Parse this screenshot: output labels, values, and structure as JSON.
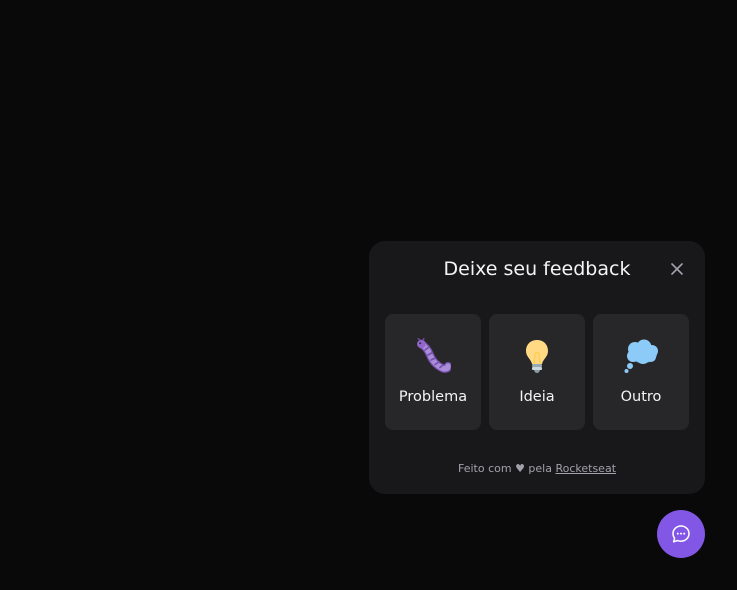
{
  "widget": {
    "title": "Deixe seu feedback",
    "close_icon": "close-icon",
    "types": [
      {
        "label": "Problema",
        "icon": "bug-icon"
      },
      {
        "label": "Ideia",
        "icon": "lightbulb-icon"
      },
      {
        "label": "Outro",
        "icon": "thought-cloud-icon"
      }
    ],
    "footer": {
      "prefix": "Feito com ♥ pela",
      "link": "Rocketseat"
    }
  },
  "fab": {
    "icon": "chat-icon"
  },
  "colors": {
    "background": "#09090a",
    "panel": "#18181b",
    "card": "#27272a",
    "brand": "#8257e5"
  }
}
